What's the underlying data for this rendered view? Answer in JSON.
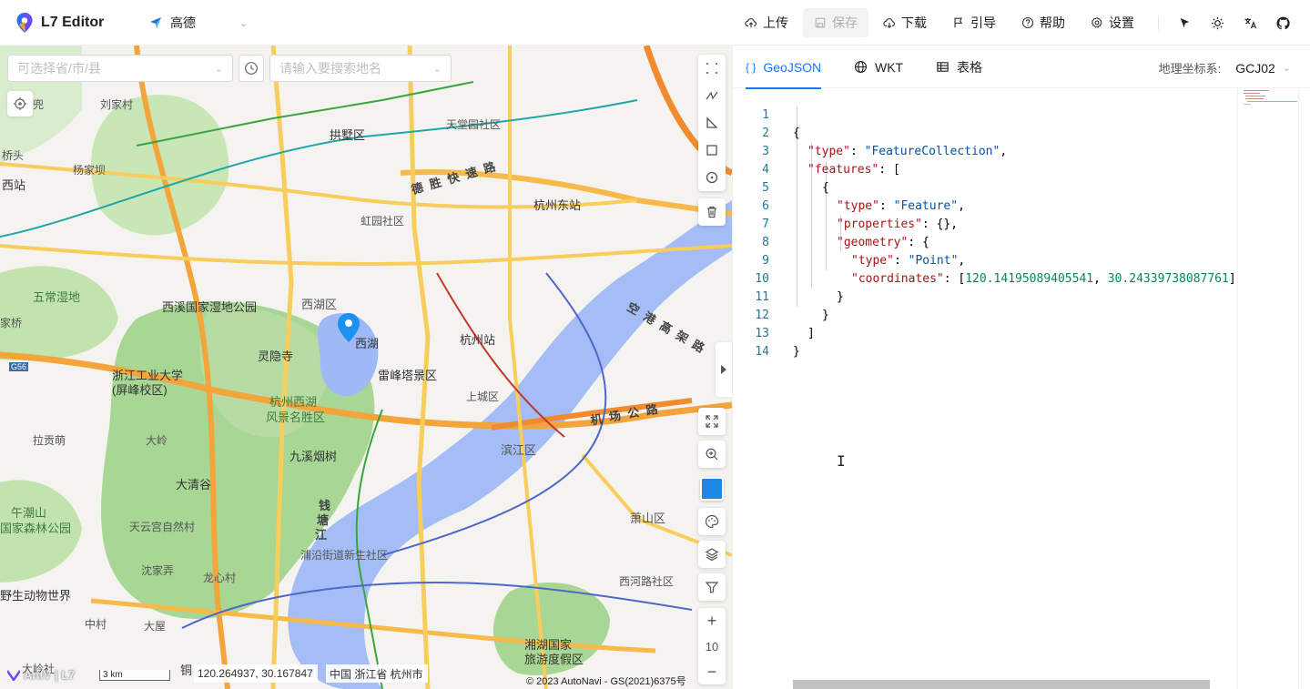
{
  "app": {
    "title": "L7 Editor",
    "provider": "高德"
  },
  "toolbar": {
    "upload": "上传",
    "save": "保存",
    "download": "下载",
    "guide": "引导",
    "help": "帮助",
    "settings": "设置"
  },
  "map": {
    "region_placeholder": "可选择省/市/县",
    "search_placeholder": "请输入要搜索地名",
    "coords": "120.264937, 30.167847",
    "location": "中国 浙江省 杭州市",
    "scale": "3 km",
    "zoom": "10",
    "copyright": "© 2023 AutoNavi - GS(2021)6375号",
    "brand": "AntV | L7",
    "feature_color": "#1e88e5",
    "labels": {
      "l1": "兜",
      "l2": "刘家村",
      "l3": "拱墅区",
      "l4": "天堂园社区",
      "l5": "桥头",
      "l6": "杨家坝",
      "l7": "西站",
      "l8": "德 胜 快 速 路",
      "l9": "杭州东站",
      "l10": "虹园社区",
      "l11": "五常湿地",
      "l12": "西溪国家湿地公园",
      "l13": "西湖区",
      "l14": "家桥",
      "l15": "灵隐寺",
      "l16": "西湖",
      "l17": "杭州站",
      "l18": "雷峰塔景区",
      "l19": "浙江工业大学",
      "l20": "(屏峰校区)",
      "l21": "杭州西湖",
      "l22": "风景名胜区",
      "l23": "上城区",
      "l24": "机 场 公 路",
      "l25": "拉贡萌",
      "l26": "大岭",
      "l27": "九溪烟树",
      "l28": "滨江区",
      "l29": "午潮山",
      "l30": "国家森林公园",
      "l31": "大清谷",
      "l32": "钱",
      "l33": "塘",
      "l34": "江",
      "l35": "天云宫自然村",
      "l36": "萧山区",
      "l37": "浦沿街道新生社区",
      "l38": "沈家弄",
      "l39": "龙心村",
      "l40": "西河路社区",
      "l41": "野生动物世界",
      "l42": "中村",
      "l43": "大屋",
      "l44": "湘湖国家",
      "l45": "旅游度假区",
      "l46": "空 港 高 架 路",
      "l47": "大岭社",
      "l48": "铜",
      "l49": "G56"
    }
  },
  "panel": {
    "tabs": [
      "GeoJSON",
      "WKT",
      "表格"
    ],
    "coord_label": "地理坐标系:",
    "coord_value": "GCJ02"
  },
  "editor": {
    "line_numbers": [
      "1",
      "2",
      "3",
      "4",
      "5",
      "6",
      "7",
      "8",
      "9",
      "10",
      "11",
      "12",
      "13",
      "14"
    ],
    "l1": "{",
    "l2k": "\"type\"",
    "l2v": "\"FeatureCollection\"",
    "l3k": "\"features\"",
    "l3v": "[",
    "l4": "{",
    "l5k": "\"type\"",
    "l5v": "\"Feature\"",
    "l6k": "\"properties\"",
    "l6v": "{},",
    "l7k": "\"geometry\"",
    "l7v": "{",
    "l8k": "\"type\"",
    "l8v": "\"Point\"",
    "l9k": "\"coordinates\"",
    "l9a": "120.14195089405541",
    "l9b": "30.24339738087761",
    "l10": "}",
    "l11": "}",
    "l12": "]",
    "l13": "}"
  }
}
